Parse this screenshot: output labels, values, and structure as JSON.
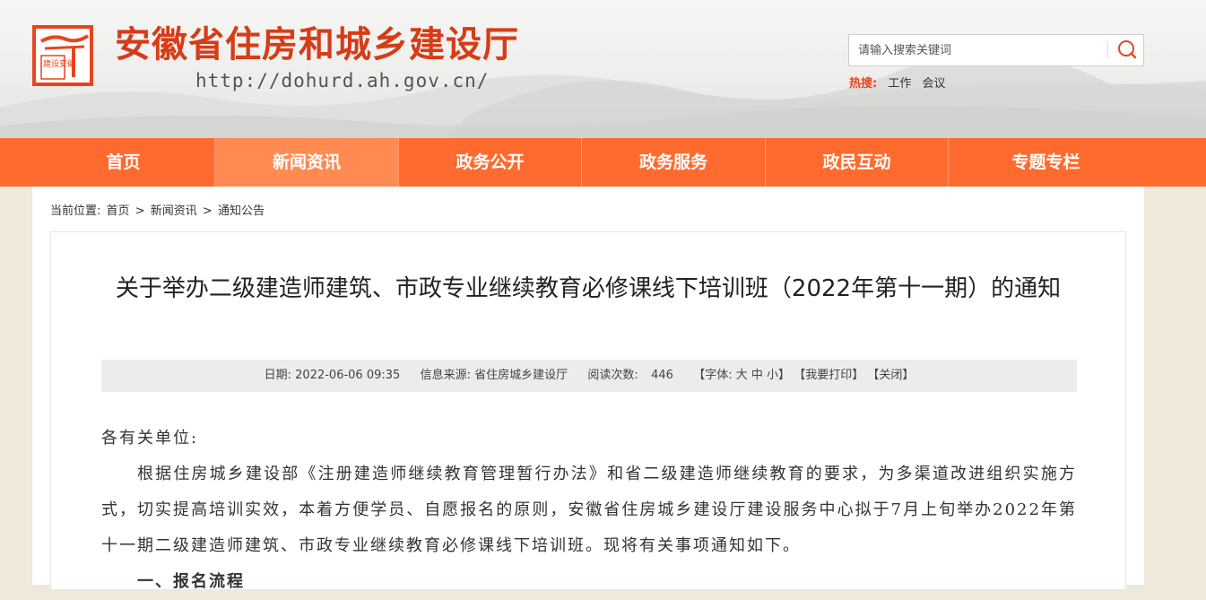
{
  "header": {
    "site_title": "安徽省住房和城乡建设厅",
    "site_url": "http://dohurd.ah.gov.cn/",
    "logo_text": "建设安徽"
  },
  "search": {
    "placeholder": "请输入搜索关键词",
    "button_icon": "search-icon"
  },
  "hot": {
    "label": "热搜:",
    "links": [
      "工作",
      "会议"
    ]
  },
  "nav": {
    "items": [
      {
        "label": "首页"
      },
      {
        "label": "新闻资讯"
      },
      {
        "label": "政务公开"
      },
      {
        "label": "政务服务"
      },
      {
        "label": "政民互动"
      },
      {
        "label": "专题专栏"
      }
    ],
    "active_index": 1
  },
  "breadcrumb": {
    "prefix": "当前位置:",
    "items": [
      "首页",
      "新闻资讯",
      "通知公告"
    ],
    "separator": ">"
  },
  "article": {
    "title": "关于举办二级建造师建筑、市政专业继续教育必修课线下培训班（2022年第十一期）的通知",
    "meta": {
      "date_label": "日期:",
      "date": "2022-06-06 09:35",
      "source_label": "信息来源:",
      "source": "省住房城乡建设厅",
      "views_label": "阅读次数:",
      "views": "446",
      "font_label": "【字体:",
      "font_large": "大",
      "font_medium": "中",
      "font_small": "小】",
      "print": "【我要打印】",
      "close": "【关闭】"
    },
    "salutation": "各有关单位:",
    "paragraph1": "根据住房城乡建设部《注册建造师继续教育管理暂行办法》和省二级建造师继续教育的要求，为多渠道改进组织实施方式，切实提高培训实效，本着方便学员、自愿报名的原则，安徽省住房城乡建设厅建设服务中心拟于7月上旬举办2022年第十一期二级建造师建筑、市政专业继续教育必修课线下培训班。现将有关事项通知如下。",
    "section1": "一、报名流程"
  },
  "colors": {
    "brand_red": "#d63c17",
    "nav_orange": "#ff6b2e",
    "nav_active": "#ff8a52"
  }
}
